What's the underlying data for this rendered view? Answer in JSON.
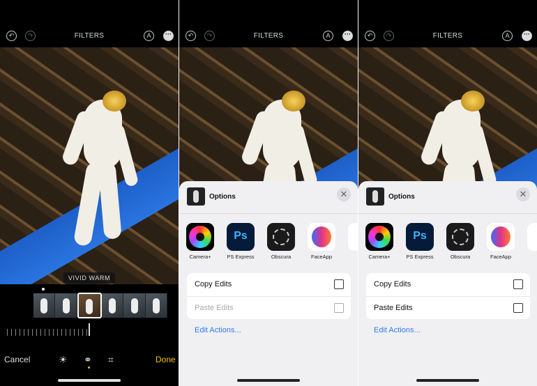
{
  "colors": {
    "accent": "#f2c200",
    "link": "#2f7bf5",
    "sheet_bg": "#f0f0f3"
  },
  "panels": [
    {
      "title": "FILTERS",
      "icons": [
        "undo-icon",
        "redo-icon",
        "markup-icon",
        "more-icon"
      ],
      "filter_label": "VIVID WARM",
      "selected_filter_index": 2,
      "filter_count": 6,
      "toolbar": {
        "cancel": "Cancel",
        "done": "Done",
        "tools": [
          "adjust-icon",
          "filters-icon",
          "crop-icon"
        ],
        "active_tool": "filters-icon"
      }
    },
    {
      "title": "FILTERS",
      "icons": [
        "undo-icon",
        "redo-icon",
        "markup-icon",
        "more-icon"
      ],
      "sheet": {
        "title": "Options",
        "apps": [
          {
            "label": "Camera+"
          },
          {
            "label": "PS Express"
          },
          {
            "label": "Obscura"
          },
          {
            "label": "FaceApp"
          }
        ],
        "actions": [
          {
            "label": "Copy Edits",
            "enabled": true
          },
          {
            "label": "Paste Edits",
            "enabled": false
          }
        ],
        "edit_actions": "Edit Actions..."
      }
    },
    {
      "title": "FILTERS",
      "icons": [
        "undo-icon",
        "redo-icon",
        "markup-icon",
        "more-icon"
      ],
      "sheet": {
        "title": "Options",
        "apps": [
          {
            "label": "Camera+"
          },
          {
            "label": "PS Express"
          },
          {
            "label": "Obscura"
          },
          {
            "label": "FaceApp"
          }
        ],
        "actions": [
          {
            "label": "Copy Edits",
            "enabled": true
          },
          {
            "label": "Paste Edits",
            "enabled": true
          }
        ],
        "edit_actions": "Edit Actions..."
      }
    }
  ]
}
